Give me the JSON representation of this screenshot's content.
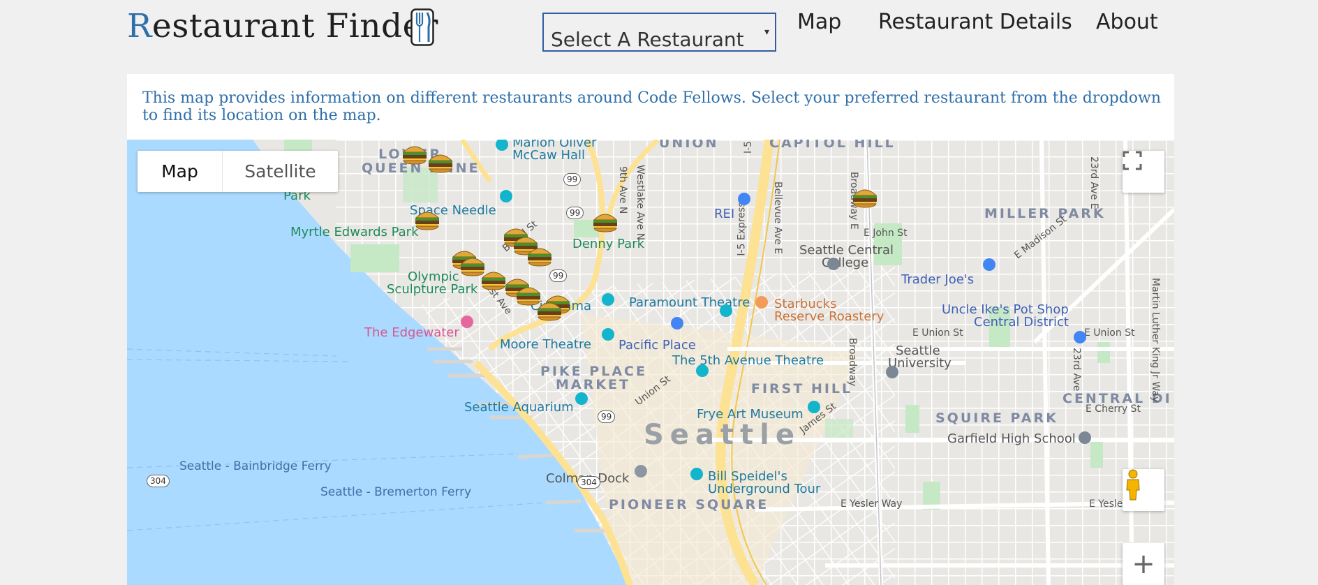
{
  "header": {
    "logo_first_letter": "R",
    "logo_rest": "estaurant Finder",
    "logo_icon": "fork-knife-icon",
    "select": {
      "value": "Select A Restaurant",
      "caret": "▾"
    },
    "nav": [
      "Map",
      "Restaurant Details",
      "About"
    ]
  },
  "description": "This map provides information on different restaurants around Code Fellows. Select your preferred restaurant from the dropdown to find its location on the map.",
  "map": {
    "type_buttons": {
      "map": "Map",
      "satellite": "Satellite"
    },
    "zoom_in": "+",
    "marker_icon": "burger-icon",
    "labels": {
      "lower": "LOWER",
      "queen_anne": "QUEEN ANNE",
      "park": "Park",
      "union": "UNION",
      "capitol_hill": "CAPITOL HILL",
      "marion_oliver": "Marion Oliver",
      "mccaw_hall": "McCaw Hall",
      "space_needle": "Space Needle",
      "myrtle_edwards": "Myrtle Edwards Park",
      "denny_park": "Denny Park",
      "rei": "REI",
      "miller_park": "MILLER PARK",
      "e_john_st": "E John St",
      "seattle_central": "Seattle Central",
      "college": "College",
      "trader_joes": "Trader Joe's",
      "e_madison_st": "E Madison St",
      "olympic": "Olympic",
      "sculpture_park": "Sculpture Park",
      "paramount": "Paramount Theatre",
      "starbucks": "Starbucks",
      "reserve_roastery": "Reserve Roastery",
      "uncle_ikes": "Uncle Ike's Pot Shop",
      "central_district": "Central District",
      "cinerama": "Cinerama",
      "edgewater": "The Edgewater",
      "moore": "Moore Theatre",
      "pacific_place": "Pacific Place",
      "e_union_st_1": "E Union St",
      "e_union_st_2": "E Union St",
      "fifth_ave": "The 5th Avenue Theatre",
      "seattle_univ_1": "Seattle",
      "seattle_univ_2": "University",
      "pike_place_1": "PIKE PLACE",
      "pike_place_2": "MARKET",
      "first_hill": "FIRST HILL",
      "central_di": "CENTRAL DI",
      "e_cherry_st": "E Cherry St",
      "seattle_aquarium": "Seattle Aquarium",
      "frye": "Frye Art Museum",
      "squire_park": "SQUIRE PARK",
      "seattle_city": "Seattle",
      "garfield": "Garfield High School",
      "bainbridge_ferry": "Seattle - Bainbridge Ferry",
      "bremerton_ferry": "Seattle - Bremerton Ferry",
      "colman_dock": "Colman Dock",
      "bill_speidel_1": "Bill Speidel's",
      "bill_speidel_2": "Underground Tour",
      "pioneer_square": "PIONEER SQUARE",
      "e_yesler_way": "E Yesler Way",
      "e_yesle": "E Yesle",
      "broad_st": "Broad St",
      "first_ave": "1st Ave",
      "ninth_ave": "9th Ave N",
      "westlake": "Westlake Ave N",
      "i5_express": "I-5 Express",
      "bellevue": "Bellevue Ave E",
      "broadway_e": "Broadway E",
      "broadway": "Broadway",
      "twentythird_1": "23rd Ave E",
      "twentythird_2": "23rd Ave",
      "mlk": "Martin Luther King Jr Way",
      "union_st": "Union St",
      "james_st": "James St",
      "i5_short": "I-5"
    },
    "shields": [
      "99",
      "99",
      "99",
      "99",
      "304",
      "304"
    ]
  }
}
